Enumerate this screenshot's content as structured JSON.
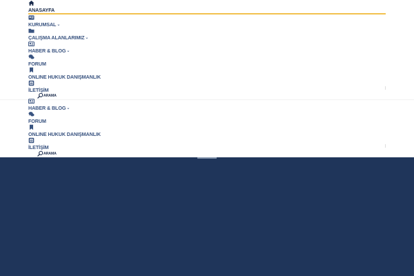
{
  "menu": {
    "home": "ANASAYFA",
    "corporate": "KURUMSAL",
    "practice_areas": "ÇALIŞMA ALANLARIMIZ",
    "news_blog": "HABER & BLOG",
    "forum": "FORUM",
    "online_consulting": "ONLINE HUKUK DANIŞMANLIK",
    "contact": "İLETİŞİM",
    "search": "ARAMA"
  },
  "colors": {
    "active_underline": "#f2c14e",
    "menu_text": "#3a5480",
    "active_text": "#1a2b4c",
    "hero_background": "#1f355a"
  },
  "icons": [
    "home-icon",
    "id-card-icon",
    "folder-icon",
    "newspaper-icon",
    "comments-icon",
    "bookmark-icon",
    "contact-icon",
    "search-icon"
  ]
}
